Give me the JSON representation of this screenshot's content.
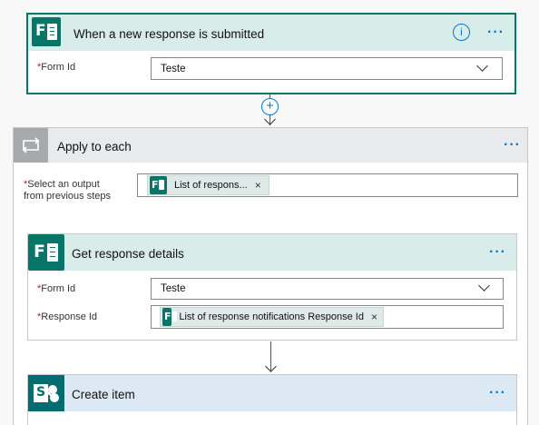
{
  "trigger": {
    "title": "When a new response is submitted",
    "form_id_label": "Form Id",
    "form_id_value": "Teste",
    "info_icon": "info-icon",
    "more_icon": "more-options-icon"
  },
  "apply_to_each": {
    "title": "Apply to each",
    "select_output_label_line1": "Select an output",
    "select_output_label_line2": "from previous steps",
    "token_text": "List of respons...",
    "remove_symbol": "×",
    "loop_icon": "loop-icon"
  },
  "get_response": {
    "title": "Get response details",
    "form_id_label": "Form Id",
    "form_id_value": "Teste",
    "response_id_label": "Response Id",
    "response_token_text": "List of response notifications Response Id",
    "remove_symbol": "×"
  },
  "create_item": {
    "title": "Create item",
    "icon": "sharepoint-icon"
  },
  "required_marker": "*",
  "add_step_symbol": "+",
  "more_dots": "···",
  "info_symbol": "i",
  "forms_letter": "F",
  "sharepoint_letter": "S",
  "colors": {
    "forms_green": "#077568",
    "forms_header_bg": "#d8ece9",
    "loop_header_bg": "#e8eaed",
    "sharepoint_blue": "#036c70",
    "sharepoint_header_bg": "#dce8f3",
    "accent_blue": "#0078d4",
    "required_red": "#a4262c"
  }
}
